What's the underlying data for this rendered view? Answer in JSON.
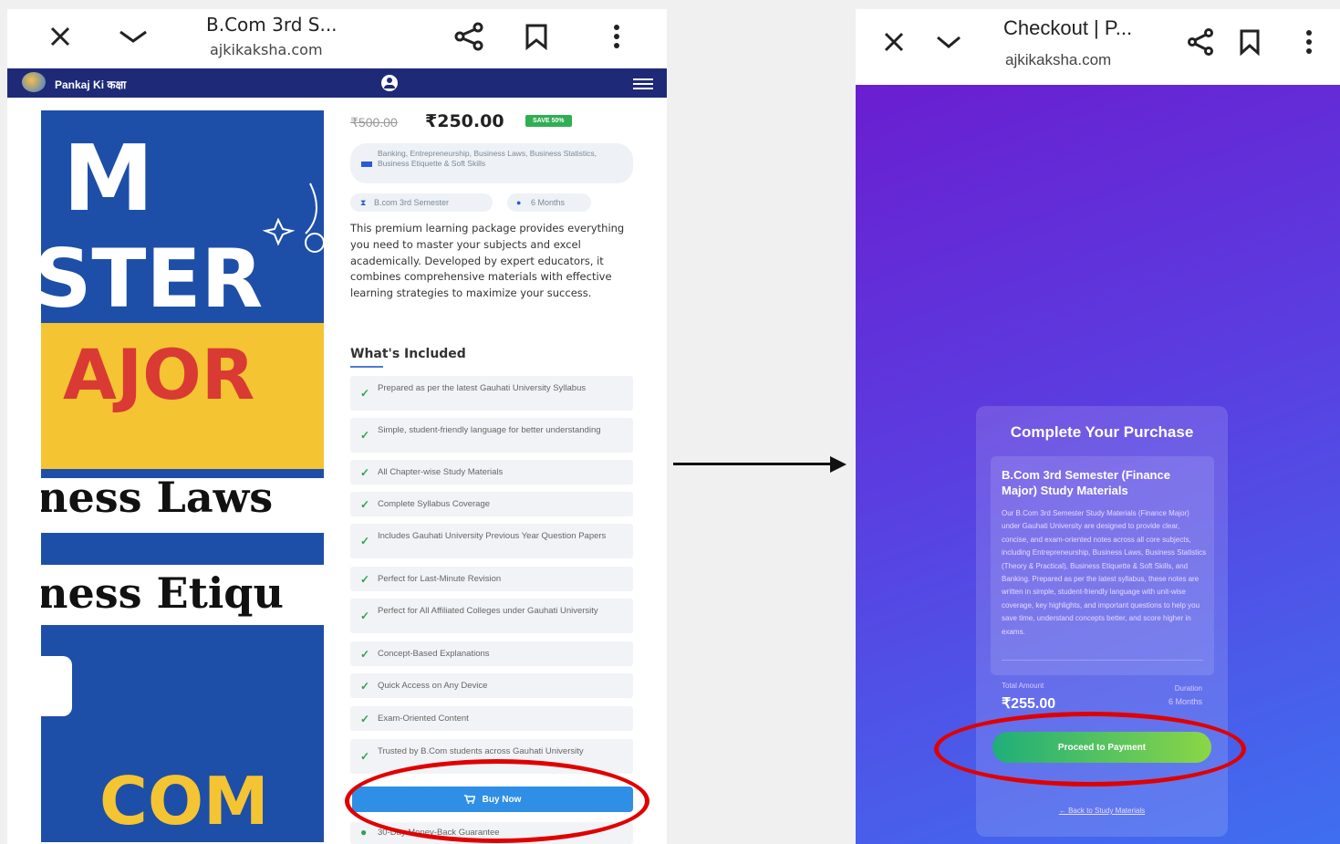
{
  "left": {
    "tab_title": "B.Com 3rd S...",
    "url": "ajkikaksha.com",
    "brand": "Pankaj Ki कक्षा",
    "hero_text": [
      "M",
      "STER",
      "AJOR",
      "ness Laws",
      "ness Etiqu",
      "COM"
    ],
    "price": {
      "old": "₹500.00",
      "new": "₹250.00",
      "save": "SAVE 50%"
    },
    "subjects": "Banking, Entrepreneurship, Business Laws, Business Statistics, Business Etiquette & Soft Skills",
    "pills": {
      "semester": "B.com 3rd Semester",
      "duration": "6 Months"
    },
    "description": "This premium learning package provides everything you need to master your subjects and excel academically. Developed by expert educators, it combines comprehensive materials with effective learning strategies to maximize your success.",
    "included_heading": "What's Included",
    "features": [
      "Prepared as per the latest Gauhati University Syllabus",
      "Simple, student-friendly language for better understanding",
      "All Chapter-wise Study Materials",
      "Complete Syllabus Coverage",
      "Includes Gauhati University Previous Year Question Papers",
      "Perfect for Last-Minute Revision",
      "Perfect for All Affiliated Colleges under Gauhati University",
      "Concept-Based Explanations",
      "Quick Access on Any Device",
      "Exam-Oriented Content",
      "Trusted by B.Com students across Gauhati University"
    ],
    "buy_label": "Buy Now",
    "guarantee": "30-Day Money-Back Guarantee"
  },
  "right": {
    "tab_title": "Checkout | P...",
    "url": "ajkikaksha.com",
    "card_title": "Complete Your Purchase",
    "product_title": "B.Com 3rd Semester (Finance Major) Study Materials",
    "product_desc": "Our B.Com 3rd Semester Study Materials (Finance Major) under Gauhati University are designed to provide clear, concise, and exam-oriented notes across all core subjects, including Entrepreneurship, Business Laws, Business Statistics (Theory & Practical), Business Etiquette & Soft Skills, and Banking. Prepared as per the latest syllabus, these notes are written in simple, student-friendly language with unit-wise coverage, key highlights, and important questions to help you save time, understand concepts better, and score higher in exams.",
    "total_label": "Total Amount",
    "total_value": "₹255.00",
    "duration_label": "Duration",
    "duration_value": "6 Months",
    "pay_label": "Proceed to Payment",
    "back_label": "← Back to Study Materials"
  },
  "colors": {
    "navbar": "#1e2a78",
    "buy": "#2f8fe6",
    "highlight": "#e00000"
  }
}
